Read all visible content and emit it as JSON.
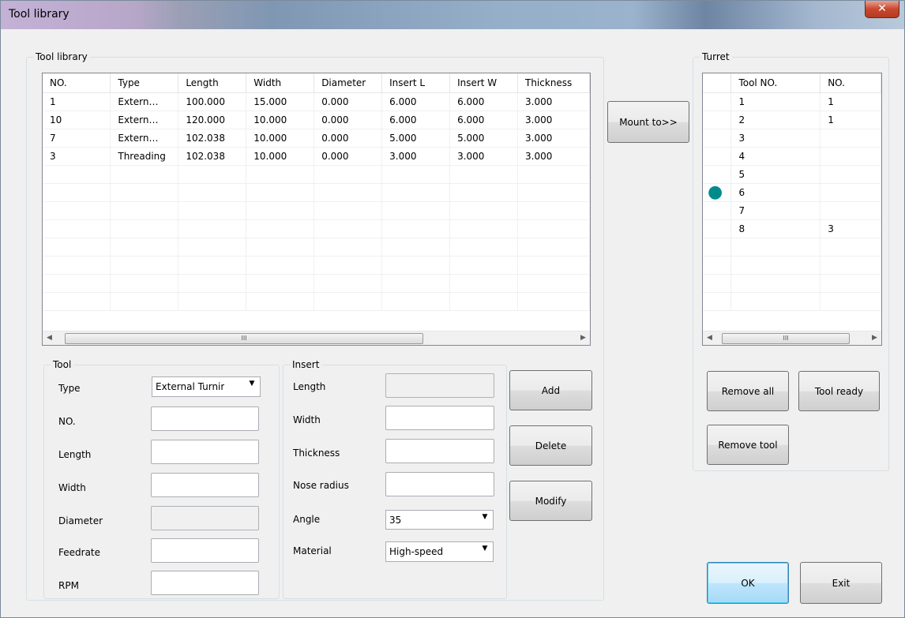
{
  "window": {
    "title": "Tool library",
    "close_glyph": "✕"
  },
  "library": {
    "legend": "Tool library",
    "columns": [
      "NO.",
      "Type",
      "Length",
      "Width",
      "Diameter",
      "Insert L",
      "Insert W",
      "Thickness"
    ],
    "rows": [
      [
        "1",
        "Extern…",
        "100.000",
        "15.000",
        "0.000",
        "6.000",
        "6.000",
        "3.000"
      ],
      [
        "10",
        "Extern…",
        "120.000",
        "10.000",
        "0.000",
        "6.000",
        "6.000",
        "3.000"
      ],
      [
        "7",
        "Extern…",
        "102.038",
        "10.000",
        "0.000",
        "5.000",
        "5.000",
        "3.000"
      ],
      [
        "3",
        "Threading",
        "102.038",
        "10.000",
        "0.000",
        "3.000",
        "3.000",
        "3.000"
      ]
    ],
    "scroll_thumb_glyph": "III"
  },
  "mount_button": "Mount to>>",
  "turret": {
    "legend": "Turret",
    "columns": [
      "",
      "Tool NO.",
      "NO."
    ],
    "rows": [
      [
        "",
        "1",
        "1"
      ],
      [
        "",
        "2",
        "1"
      ],
      [
        "",
        "3",
        ""
      ],
      [
        "",
        "4",
        ""
      ],
      [
        "",
        "5",
        ""
      ],
      [
        "●",
        "6",
        ""
      ],
      [
        "",
        "7",
        ""
      ],
      [
        "",
        "8",
        "3"
      ]
    ],
    "active_row_color": "#008b8b",
    "scroll_thumb_glyph": "III"
  },
  "tool": {
    "legend": "Tool",
    "type_label": "Type",
    "type_value": "External Turnir",
    "no_label": "NO.",
    "length_label": "Length",
    "width_label": "Width",
    "diameter_label": "Diameter",
    "feedrate_label": "Feedrate",
    "rpm_label": "RPM"
  },
  "insert": {
    "legend": "Insert",
    "length_label": "Length",
    "width_label": "Width",
    "thickness_label": "Thickness",
    "nose_radius_label": "Nose radius",
    "angle_label": "Angle",
    "angle_value": "35",
    "material_label": "Material",
    "material_value": "High-speed"
  },
  "buttons": {
    "add": "Add",
    "delete": "Delete",
    "modify": "Modify",
    "remove_all": "Remove all",
    "tool_ready": "Tool ready",
    "remove_tool": "Remove tool",
    "ok": "OK",
    "exit": "Exit"
  },
  "icons": {
    "dropdown": "chevron-down-icon",
    "scroll_left": "arrow-left-icon",
    "scroll_right": "arrow-right-icon",
    "close": "close-icon"
  }
}
